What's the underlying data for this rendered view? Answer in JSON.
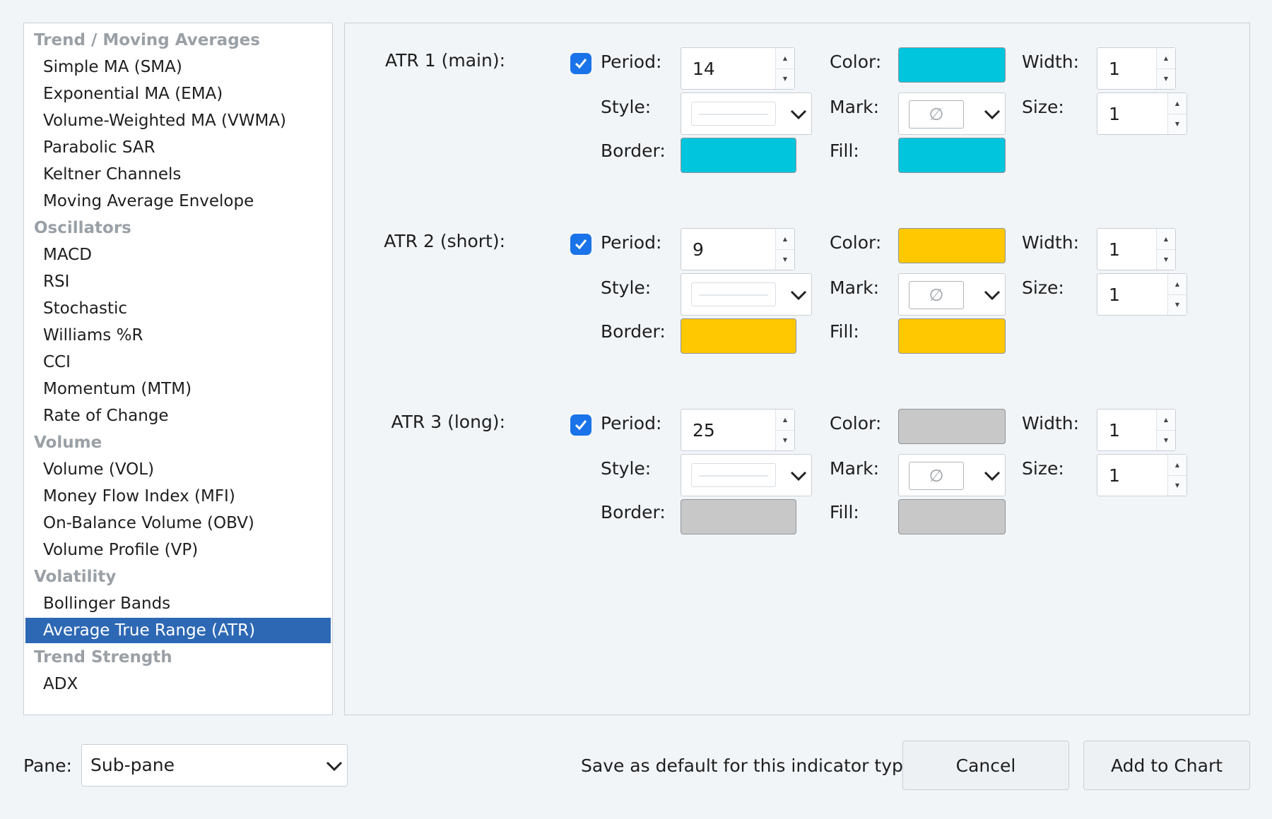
{
  "indicator_list": {
    "rows": [
      {
        "type": "group",
        "label": "Trend / Moving Averages"
      },
      {
        "type": "item",
        "label": "Simple MA (SMA)"
      },
      {
        "type": "item",
        "label": "Exponential MA (EMA)"
      },
      {
        "type": "item",
        "label": "Volume-Weighted MA (VWMA)"
      },
      {
        "type": "item",
        "label": "Parabolic SAR"
      },
      {
        "type": "item",
        "label": "Keltner Channels"
      },
      {
        "type": "item",
        "label": "Moving Average Envelope"
      },
      {
        "type": "group",
        "label": "Oscillators"
      },
      {
        "type": "item",
        "label": "MACD"
      },
      {
        "type": "item",
        "label": "RSI"
      },
      {
        "type": "item",
        "label": "Stochastic"
      },
      {
        "type": "item",
        "label": "Williams %R"
      },
      {
        "type": "item",
        "label": "CCI"
      },
      {
        "type": "item",
        "label": "Momentum (MTM)"
      },
      {
        "type": "item",
        "label": "Rate of Change"
      },
      {
        "type": "group",
        "label": "Volume"
      },
      {
        "type": "item",
        "label": "Volume (VOL)"
      },
      {
        "type": "item",
        "label": "Money Flow Index (MFI)"
      },
      {
        "type": "item",
        "label": "On-Balance Volume (OBV)"
      },
      {
        "type": "item",
        "label": "Volume Profile (VP)"
      },
      {
        "type": "group",
        "label": "Volatility"
      },
      {
        "type": "item",
        "label": "Bollinger Bands"
      },
      {
        "type": "item",
        "label": "Average True Range (ATR)",
        "selected": true
      },
      {
        "type": "group",
        "label": "Trend Strength"
      },
      {
        "type": "item",
        "label": "ADX"
      }
    ]
  },
  "labels": {
    "period": "Period:",
    "color": "Color:",
    "width": "Width:",
    "style": "Style:",
    "mark": "Mark:",
    "size": "Size:",
    "border": "Border:",
    "fill": "Fill:"
  },
  "series": [
    {
      "title": "ATR 1 (main):",
      "enabled": true,
      "period": "14",
      "color": "#00c5dc",
      "width": "1",
      "size": "1",
      "border": "#00c5dc",
      "fill": "#00c5dc",
      "mark_icon": "empty-set-icon"
    },
    {
      "title": "ATR 2 (short):",
      "enabled": true,
      "period": "9",
      "color": "#ffc800",
      "width": "1",
      "size": "1",
      "border": "#ffc800",
      "fill": "#ffc800",
      "mark_icon": "empty-set-icon"
    },
    {
      "title": "ATR 3 (long):",
      "enabled": true,
      "period": "25",
      "color": "#c8c8c8",
      "width": "1",
      "size": "1",
      "border": "#c8c8c8",
      "fill": "#c8c8c8",
      "mark_icon": "empty-set-icon"
    }
  ],
  "footer": {
    "pane_label": "Pane:",
    "pane_value": "Sub-pane",
    "save_default_label": "Save as default for this indicator type",
    "cancel_label": "Cancel",
    "add_label": "Add to Chart"
  },
  "colors": {
    "selection": "#2d68b4",
    "checkbox": "#1a73e8"
  }
}
